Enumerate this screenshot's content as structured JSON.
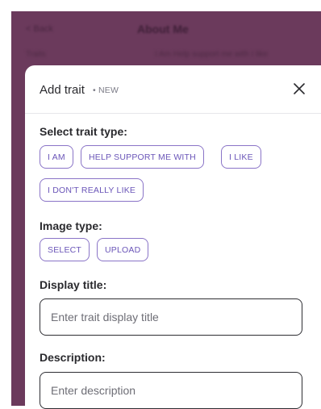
{
  "background": {
    "back_label": "< Back",
    "title": "About Me",
    "sub_left": "Traits",
    "sub_right": "I Am  Help support me with  I like"
  },
  "modal": {
    "title": "Add trait",
    "badge": "• NEW",
    "close_label": "Close"
  },
  "trait_type": {
    "label": "Select trait type:",
    "options": [
      "I AM",
      "HELP SUPPORT ME WITH",
      "I LIKE",
      "I DON'T REALLY LIKE"
    ]
  },
  "image_type": {
    "label": "Image type:",
    "options": [
      "SELECT",
      "UPLOAD"
    ]
  },
  "display_title": {
    "label": "Display title:",
    "placeholder": "Enter trait display title",
    "value": ""
  },
  "description": {
    "label": "Description:",
    "placeholder": "Enter description",
    "value": ""
  },
  "colors": {
    "backdrop": "#6b3a5c",
    "accent": "#6a55b8",
    "chip_border": "#8a74c7"
  }
}
